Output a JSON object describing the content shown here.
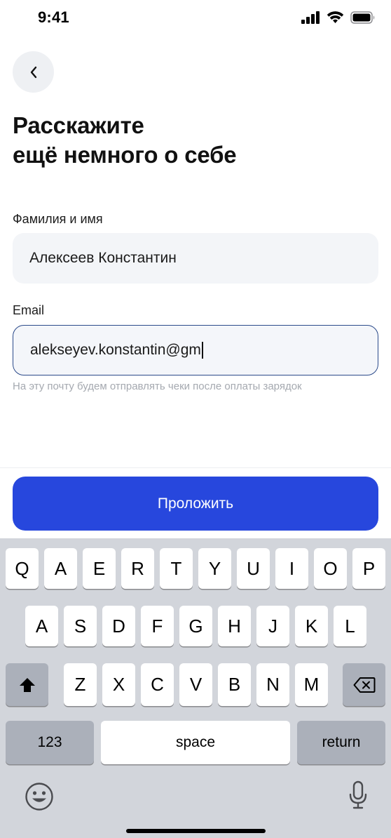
{
  "status_bar": {
    "time": "9:41",
    "icons": [
      "cellular-signal-icon",
      "wifi-icon",
      "battery-icon"
    ]
  },
  "header": {
    "back_icon": "chevron-left-icon",
    "title_line1": "Расскажите",
    "title_line2": "ещё немного о себе"
  },
  "form": {
    "name": {
      "label": "Фамилия и имя",
      "value": "Алексеев Константин"
    },
    "email": {
      "label": "Email",
      "value": "alekseyev.konstantin@gm",
      "hint": "На эту почту будем отправлять чеки после оплаты зарядок"
    }
  },
  "primary_button": {
    "label": "Проложить"
  },
  "keyboard": {
    "row1": [
      "Q",
      "A",
      "E",
      "R",
      "T",
      "Y",
      "U",
      "I",
      "O",
      "P"
    ],
    "row2": [
      "A",
      "S",
      "D",
      "F",
      "G",
      "H",
      "J",
      "K",
      "L"
    ],
    "row3": [
      "Z",
      "X",
      "C",
      "V",
      "B",
      "N",
      "M"
    ],
    "numbers_label": "123",
    "space_label": "space",
    "return_label": "return",
    "icons": [
      "shift-icon",
      "delete-icon",
      "emoji-icon",
      "microphone-icon"
    ]
  },
  "colors": {
    "accent": "#2747DD",
    "focus_border": "#2B4A8A",
    "input_bg": "#F3F5F8",
    "keyboard_bg": "#D2D5DB"
  }
}
